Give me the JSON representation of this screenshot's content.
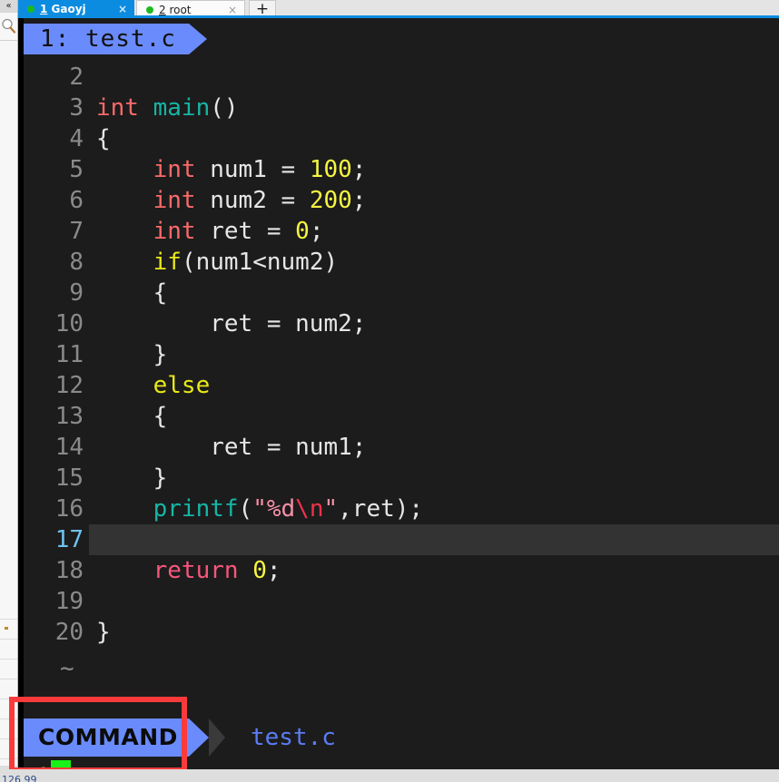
{
  "app": {
    "type": "terminal-emulator-with-vim",
    "colors": {
      "tab_active_bg": "#0b8ce0",
      "terminal_bg": "#1c1c1c",
      "vim_accent_blue": "#6a8bfb",
      "cursor_green": "#18f218",
      "annotation_red": "#fb3b3b",
      "current_line_highlight": "#333333"
    }
  },
  "sidebar": {
    "collapse_glyph": "«",
    "search_icon": "magnifier-icon",
    "rows": [
      "",
      "",
      "",
      "",
      "",
      "",
      "",
      ""
    ]
  },
  "tabbar": {
    "tabs": [
      {
        "number": "1",
        "label": " Gaoyj",
        "full": "1 Gaoyj",
        "active": true,
        "close_glyph": "×",
        "status_dot": "green"
      },
      {
        "number": "2",
        "label": " root",
        "full": "2 root",
        "active": false,
        "close_glyph": "×",
        "status_dot": "green"
      }
    ],
    "add_tab_glyph": "+"
  },
  "vim": {
    "tabline": {
      "index": "1:",
      "filename": "test.c",
      "text": "1: test.c"
    },
    "filler_lines": [
      "~",
      "~"
    ],
    "current_line": 17,
    "status": {
      "mode": "COMMAND",
      "filename": "test.c"
    },
    "command": {
      "prompt": ":",
      "value": ""
    },
    "code": [
      {
        "n": "2",
        "tokens": []
      },
      {
        "n": "3",
        "tokens": [
          {
            "t": "int",
            "c": "k-type"
          },
          {
            "t": " ",
            "c": "k-punct"
          },
          {
            "t": "main",
            "c": "k-func"
          },
          {
            "t": "()",
            "c": "k-punct"
          }
        ]
      },
      {
        "n": "4",
        "tokens": [
          {
            "t": "{",
            "c": "k-punct"
          }
        ]
      },
      {
        "n": "5",
        "tokens": [
          {
            "t": "    ",
            "c": "k-punct"
          },
          {
            "t": "int",
            "c": "k-type"
          },
          {
            "t": " num1 = ",
            "c": "k-id"
          },
          {
            "t": "100",
            "c": "k-num"
          },
          {
            "t": ";",
            "c": "k-punct"
          }
        ]
      },
      {
        "n": "6",
        "tokens": [
          {
            "t": "    ",
            "c": "k-punct"
          },
          {
            "t": "int",
            "c": "k-type"
          },
          {
            "t": " num2 = ",
            "c": "k-id"
          },
          {
            "t": "200",
            "c": "k-num"
          },
          {
            "t": ";",
            "c": "k-punct"
          }
        ]
      },
      {
        "n": "7",
        "tokens": [
          {
            "t": "    ",
            "c": "k-punct"
          },
          {
            "t": "int",
            "c": "k-type"
          },
          {
            "t": " ret = ",
            "c": "k-id"
          },
          {
            "t": "0",
            "c": "k-num"
          },
          {
            "t": ";",
            "c": "k-punct"
          }
        ]
      },
      {
        "n": "8",
        "tokens": [
          {
            "t": "    ",
            "c": "k-punct"
          },
          {
            "t": "if",
            "c": "k-cond"
          },
          {
            "t": "(num1<num2)",
            "c": "k-id"
          }
        ]
      },
      {
        "n": "9",
        "tokens": [
          {
            "t": "    {",
            "c": "k-punct"
          }
        ]
      },
      {
        "n": "10",
        "tokens": [
          {
            "t": "        ret = num2;",
            "c": "k-id"
          }
        ]
      },
      {
        "n": "11",
        "tokens": [
          {
            "t": "    }",
            "c": "k-punct"
          }
        ]
      },
      {
        "n": "12",
        "tokens": [
          {
            "t": "    ",
            "c": "k-punct"
          },
          {
            "t": "else",
            "c": "k-cond"
          }
        ]
      },
      {
        "n": "13",
        "tokens": [
          {
            "t": "    {",
            "c": "k-punct"
          }
        ]
      },
      {
        "n": "14",
        "tokens": [
          {
            "t": "        ret = num1;",
            "c": "k-id"
          }
        ]
      },
      {
        "n": "15",
        "tokens": [
          {
            "t": "    }",
            "c": "k-punct"
          }
        ]
      },
      {
        "n": "16",
        "tokens": [
          {
            "t": "    ",
            "c": "k-punct"
          },
          {
            "t": "printf",
            "c": "k-func"
          },
          {
            "t": "(",
            "c": "k-punct"
          },
          {
            "t": "\"%d",
            "c": "k-str"
          },
          {
            "t": "\\n",
            "c": "k-esc"
          },
          {
            "t": "\"",
            "c": "k-str"
          },
          {
            "t": ",ret);",
            "c": "k-id"
          }
        ]
      },
      {
        "n": "17",
        "tokens": [],
        "current": true
      },
      {
        "n": "18",
        "tokens": [
          {
            "t": "    ",
            "c": "k-punct"
          },
          {
            "t": "return",
            "c": "k-ret"
          },
          {
            "t": " ",
            "c": "k-punct"
          },
          {
            "t": "0",
            "c": "k-num"
          },
          {
            "t": ";",
            "c": "k-punct"
          }
        ]
      },
      {
        "n": "19",
        "tokens": []
      },
      {
        "n": "20",
        "tokens": [
          {
            "t": "}",
            "c": "k-punct"
          }
        ]
      }
    ]
  },
  "bottom_bar": {
    "clipped_text": "126 99"
  }
}
